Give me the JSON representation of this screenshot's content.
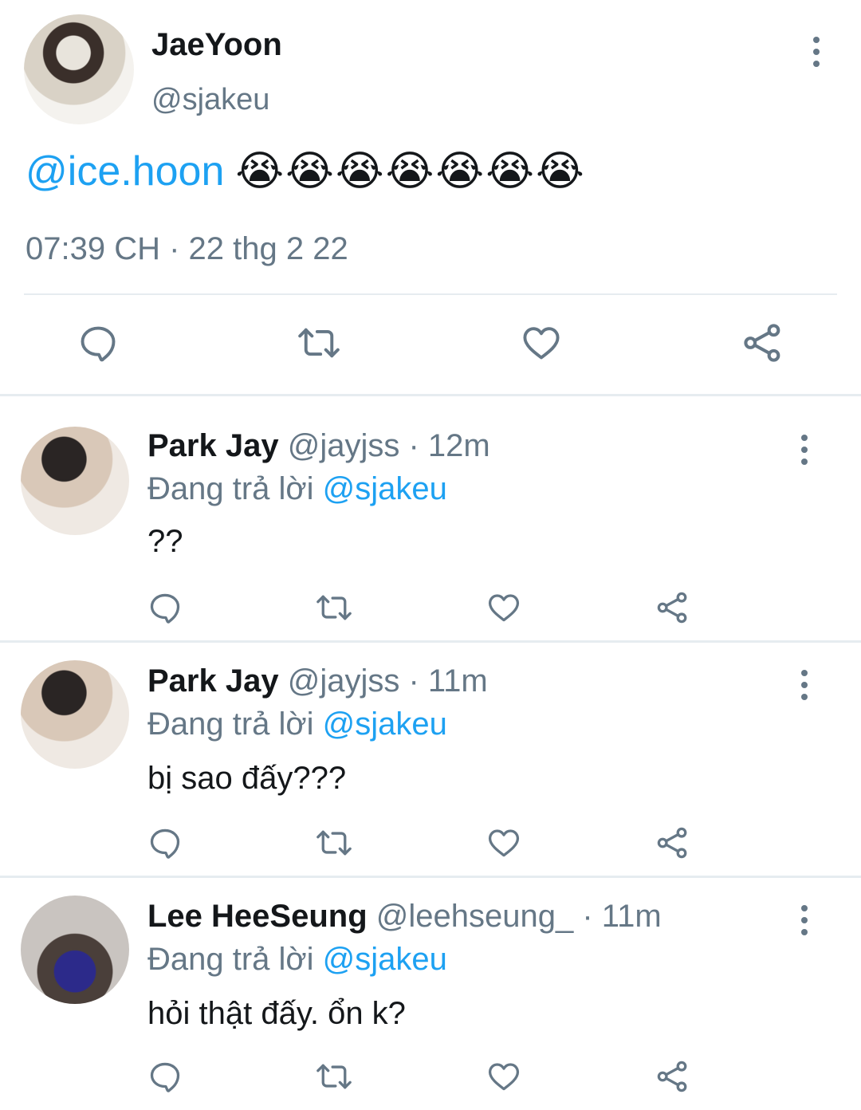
{
  "main_tweet": {
    "display_name": "JaeYoon",
    "handle": "@sjakeu",
    "mention": "@ice.hoon",
    "emojis": "😭😭😭😭😭😭😭",
    "timestamp": "07:39 CH · 22 thg 2 22"
  },
  "replies": [
    {
      "display_name": "Park Jay",
      "handle": "@jayjss",
      "time": "· 12m",
      "replying_prefix": "Đang trả lời",
      "replying_to": "@sjakeu",
      "text": "??"
    },
    {
      "display_name": "Park Jay",
      "handle": "@jayjss",
      "time": "· 11m",
      "replying_prefix": "Đang trả lời",
      "replying_to": "@sjakeu",
      "text": "bị sao đấy???"
    },
    {
      "display_name": "Lee HeeSeung",
      "handle": "@leehseung_",
      "time": "· 11m",
      "replying_prefix": "Đang trả lời",
      "replying_to": "@sjakeu",
      "text": "hỏi thật đấy. ổn k?"
    }
  ],
  "icons": {
    "reply": "speech-bubble-icon",
    "retweet": "retweet-icon",
    "like": "heart-icon",
    "share": "share-icon",
    "more": "kebab-icon"
  },
  "colors": {
    "accent": "#1da1f2",
    "secondary_text": "#657786",
    "divider": "#e6ecf0"
  }
}
